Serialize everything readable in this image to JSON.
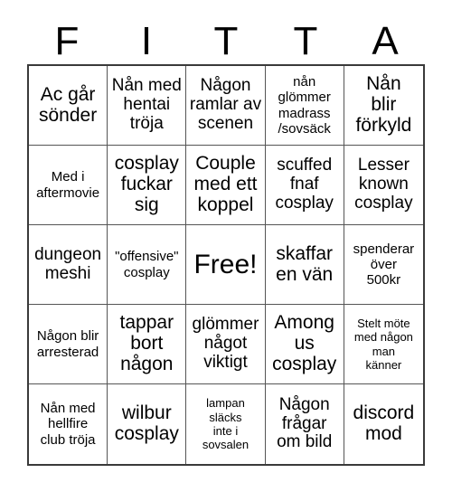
{
  "card": {
    "header_letters": [
      "F",
      "I",
      "T",
      "T",
      "A"
    ],
    "columns": 5,
    "rows": 5,
    "border_color": "#3a3a3a",
    "grid_line_color": "#555555",
    "background_color": "#ffffff",
    "text_color": "#000000",
    "cells": [
      {
        "text": "Ac går\nsönder",
        "size": "lg"
      },
      {
        "text": "Nån med\nhentai\ntröja",
        "size": "md"
      },
      {
        "text": "Någon\nramlar av\nscenen",
        "size": "md"
      },
      {
        "text": "nån\nglömmer\nmadrass\n/sovsäck",
        "size": "sm"
      },
      {
        "text": "Nån\nblir\nförkyld",
        "size": "lg"
      },
      {
        "text": "Med i\naftermovie",
        "size": "sm"
      },
      {
        "text": "cosplay\nfuckar\nsig",
        "size": "lg"
      },
      {
        "text": "Couple\nmed ett\nkoppel",
        "size": "lg"
      },
      {
        "text": "scuffed\nfnaf\ncosplay",
        "size": "md"
      },
      {
        "text": "Lesser\nknown\ncosplay",
        "size": "md"
      },
      {
        "text": "dungeon\nmeshi",
        "size": "md"
      },
      {
        "text": "\"offensive\"\ncosplay",
        "size": "sm"
      },
      {
        "text": "Free!",
        "size": "xl"
      },
      {
        "text": "skaffar\nen vän",
        "size": "lg"
      },
      {
        "text": "spenderar\növer\n500kr",
        "size": "sm"
      },
      {
        "text": "Någon blir\narresterad",
        "size": "sm"
      },
      {
        "text": "tappar\nbort\nnågon",
        "size": "lg"
      },
      {
        "text": "glömmer\nnågot\nviktigt",
        "size": "md"
      },
      {
        "text": "Among\nus\ncosplay",
        "size": "lg"
      },
      {
        "text": "Stelt möte\nmed någon\nman\nkänner",
        "size": "xs"
      },
      {
        "text": "Nån med\nhellfire\nclub tröja",
        "size": "sm"
      },
      {
        "text": "wilbur\ncosplay",
        "size": "lg"
      },
      {
        "text": "lampan\nsläcks\ninte i\nsovsalen",
        "size": "xs"
      },
      {
        "text": "Någon\nfrågar\nom bild",
        "size": "md"
      },
      {
        "text": "discord\nmod",
        "size": "lg"
      }
    ]
  }
}
